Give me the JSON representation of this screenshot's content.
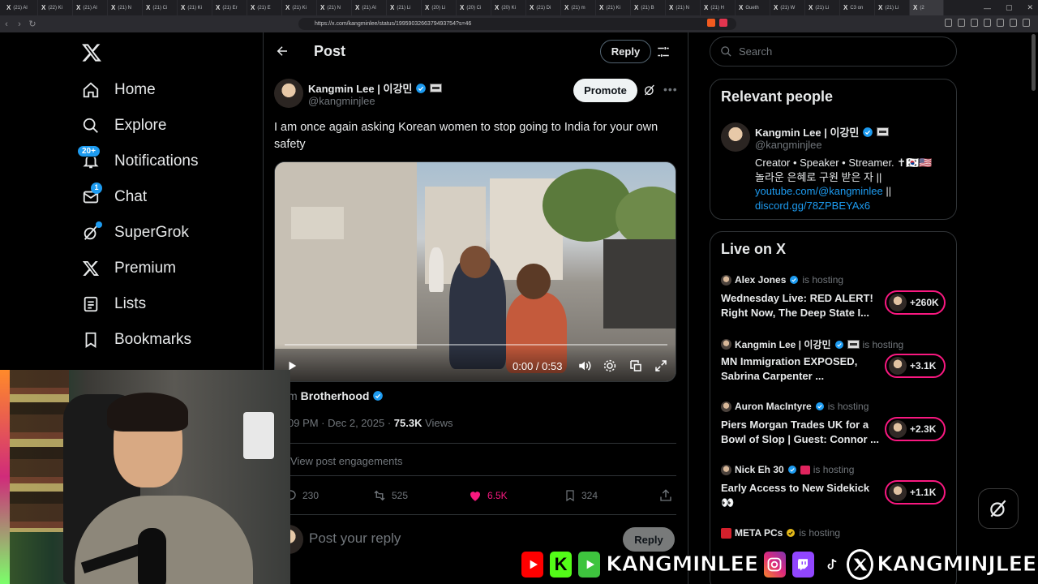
{
  "browser": {
    "tabs": [
      "(21) Al",
      "(22) Ki",
      "(21) Al",
      "(21) N",
      "(21) Ci",
      "(21) Ki",
      "(21) Er",
      "(21) E",
      "(21) Ki",
      "(21) N",
      "(21) Al",
      "(21) Li",
      "(20) Li",
      "(20) Ci",
      "(20) Ki",
      "(21) Di",
      "(21) m",
      "(21) Ki",
      "(21) B",
      "(21) N",
      "(21) H",
      "Gueth",
      "(21) W",
      "(21) Li",
      "C3 on",
      "(21) Li",
      "(2"
    ],
    "url": "https://x.com/kangminlee/status/1995903266379493754?s=46"
  },
  "nav": {
    "items": [
      {
        "label": "Home",
        "icon": "home-icon"
      },
      {
        "label": "Explore",
        "icon": "search-icon"
      },
      {
        "label": "Notifications",
        "icon": "bell-icon",
        "badge": "20+"
      },
      {
        "label": "Chat",
        "icon": "mail-icon",
        "badge": "1"
      },
      {
        "label": "SuperGrok",
        "icon": "grok-icon",
        "dot": true
      },
      {
        "label": "Premium",
        "icon": "x-icon"
      },
      {
        "label": "Lists",
        "icon": "list-icon"
      },
      {
        "label": "Bookmarks",
        "icon": "bookmark-icon"
      }
    ]
  },
  "post": {
    "header_title": "Post",
    "reply_top_label": "Reply",
    "author_name": "Kangmin Lee | 이강민",
    "author_handle": "@kangminjlee",
    "promote_label": "Promote",
    "text": "I am once again asking Korean women to stop going to India for your own safety",
    "video_time": "0:00 / 0:53",
    "from_prefix": "m",
    "from_name": "Brotherhood",
    "meta_time": "09 PM · Dec 2, 2025 · ",
    "meta_views_count": "75.3K",
    "meta_views_label": " Views",
    "engagements_label": "View post engagements",
    "stats": {
      "replies": "230",
      "reposts": "525",
      "likes": "6.5K",
      "bookmarks": "324"
    },
    "reply_placeholder": "Post your reply",
    "reply_bottom_label": "Reply"
  },
  "sidebar": {
    "search_placeholder": "Search",
    "relevant_title": "Relevant people",
    "relevant": {
      "name": "Kangmin Lee | 이강민",
      "handle": "@kangminjlee",
      "bio_line1": "Creator • Speaker • Streamer. ✝🇰🇷🇺🇸",
      "bio_line2": "놀라운 은혜로 구원 받은 자 ||",
      "link1": "youtube.com/@kangminlee",
      "link_sep": " ||",
      "link2": "discord.gg/78ZPBEYAx6"
    },
    "live_title": "Live on X",
    "live": [
      {
        "host": "Alex Jones",
        "hosting": "is hosting",
        "title": "Wednesday Live: RED ALERT! Right Now, The Deep State I...",
        "count": "+260K"
      },
      {
        "host": "Kangmin Lee | 이강민",
        "hosting": "is hosting",
        "title": "MN Immigration EXPOSED, Sabrina Carpenter ...",
        "count": "+3.1K"
      },
      {
        "host": "Auron MacIntyre",
        "hosting": "is hosting",
        "title": "Piers Morgan Trades UK for a Bowl of Slop | Guest: Connor ...",
        "count": "+2.3K"
      },
      {
        "host": "Nick Eh 30",
        "hosting": "is hosting",
        "title": "Early Access to New Sidekick 👀",
        "count": "+1.1K"
      },
      {
        "host": "META PCs",
        "hosting": "is hosting",
        "title": "",
        "count": ""
      }
    ]
  },
  "banner": {
    "handle1": "KANGMINLEE",
    "handle2": "KANGMINJLEE"
  },
  "colors": {
    "accent": "#1d9bf0",
    "like": "#f91880",
    "live_ring": "#f91880"
  }
}
